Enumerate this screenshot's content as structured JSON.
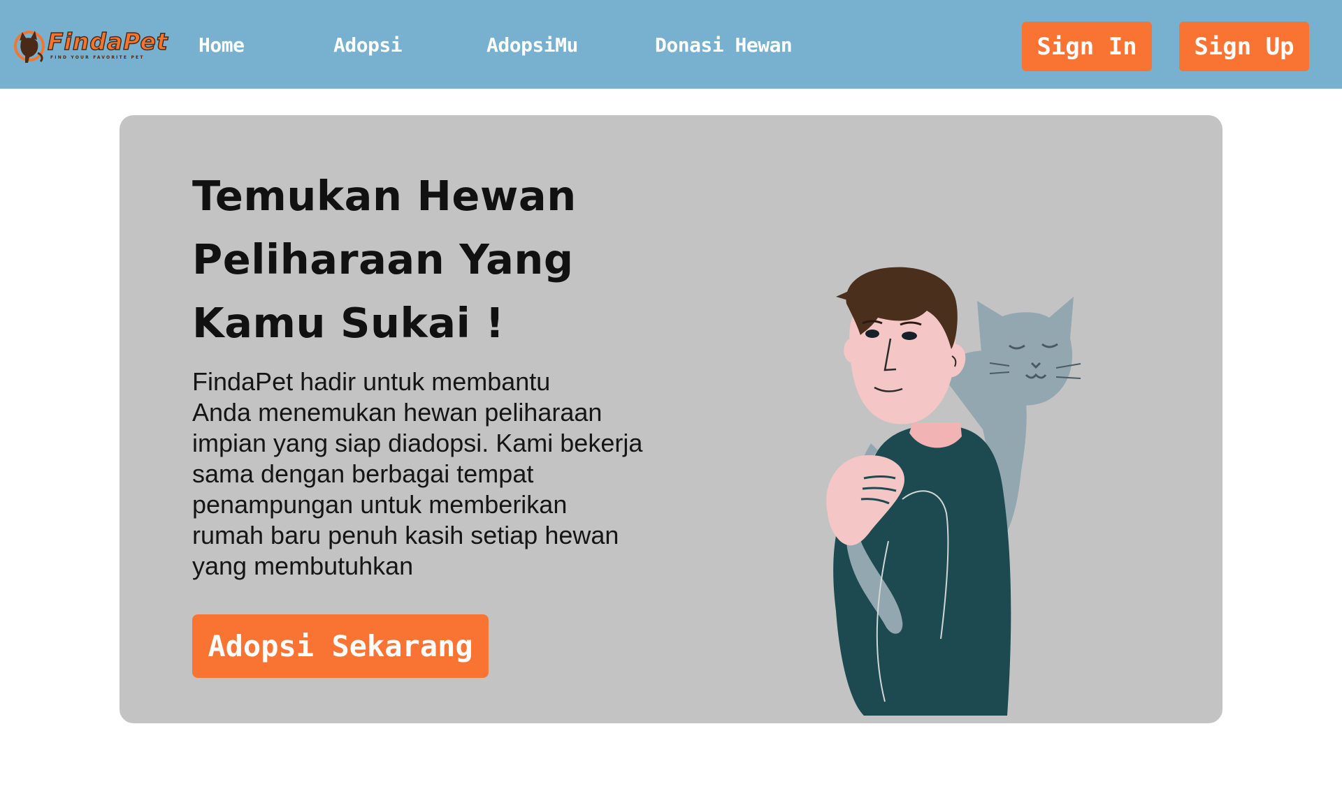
{
  "brand": {
    "name": "FindaPet",
    "tagline": "FIND YOUR FAVORITE PET",
    "color": "#f47530"
  },
  "nav": {
    "links": [
      {
        "label": "Home"
      },
      {
        "label": "Adopsi"
      },
      {
        "label": "AdopsiMu"
      },
      {
        "label": "Donasi Hewan"
      }
    ],
    "sign_in": "Sign In",
    "sign_up": "Sign Up"
  },
  "hero": {
    "title_lines": [
      "Temukan Hewan",
      "Peliharaan Yang",
      "Kamu Sukai !"
    ],
    "description": "FindaPet  hadir untuk membantu\nAnda menemukan hewan peliharaan\nimpian yang siap diadopsi. Kami bekerja\nsama dengan berbagai tempat\npenampungan untuk memberikan\nrumah baru penuh kasih setiap hewan\nyang membutuhkan",
    "cta": "Adopsi Sekarang",
    "illustration": "man-holding-cat-illustration"
  },
  "colors": {
    "navbar": "#78b1cf",
    "accent": "#f97333",
    "hero_bg": "#c3c3c3"
  }
}
